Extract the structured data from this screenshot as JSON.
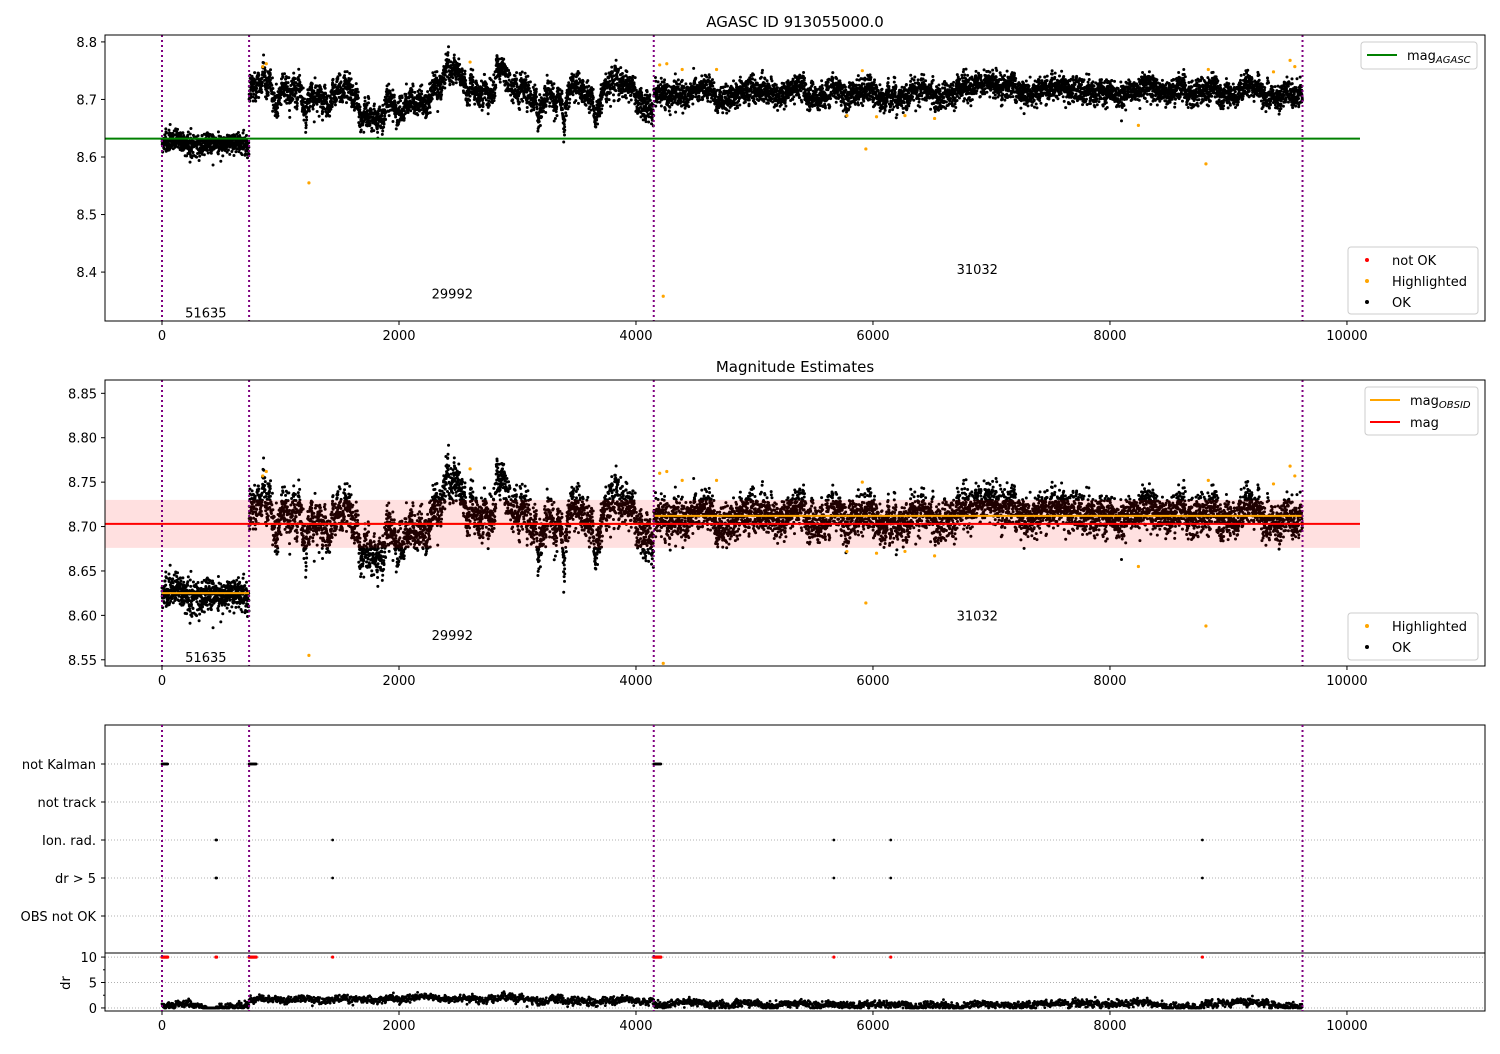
{
  "chart_data": [
    {
      "type": "scatter",
      "title": "AGASC ID 913055000.0",
      "xlim": [
        -481,
        11165
      ],
      "ylim": [
        8.315,
        8.812
      ],
      "yticks": [
        8.4,
        8.5,
        8.6,
        8.7,
        8.8
      ],
      "xticks": [
        0,
        2000,
        4000,
        6000,
        8000,
        10000
      ],
      "obsid_boundaries": [
        0,
        735,
        4150,
        9625
      ],
      "obsids": [
        {
          "label": "51635",
          "x": 370,
          "y": 8.33
        },
        {
          "label": "29992",
          "x": 2450,
          "y": 8.363
        },
        {
          "label": "31032",
          "x": 6880,
          "y": 8.405
        }
      ],
      "segments": [
        {
          "start": 0,
          "end": 735,
          "mean": 8.625,
          "std": 0.009,
          "wander": 0.004
        },
        {
          "start": 735,
          "end": 4150,
          "mean": 8.703,
          "std": 0.011,
          "wander": 0.02
        },
        {
          "start": 4150,
          "end": 9625,
          "mean": 8.712,
          "std": 0.011,
          "wander": 0.008
        }
      ],
      "mag_agasc": 8.632,
      "highlighted": [
        [
          1240,
          8.555
        ],
        [
          4230,
          8.358
        ],
        [
          5940,
          8.614
        ],
        [
          8240,
          8.655
        ],
        [
          8810,
          8.588
        ],
        [
          5780,
          8.672
        ],
        [
          6030,
          8.67
        ],
        [
          6520,
          8.667
        ],
        [
          6270,
          8.672
        ],
        [
          850,
          8.757
        ],
        [
          880,
          8.762
        ],
        [
          2600,
          8.765
        ],
        [
          4200,
          8.76
        ],
        [
          4260,
          8.762
        ],
        [
          4390,
          8.752
        ],
        [
          4680,
          8.752
        ],
        [
          5910,
          8.75
        ],
        [
          8830,
          8.752
        ],
        [
          9380,
          8.748
        ],
        [
          9520,
          8.768
        ],
        [
          9560,
          8.757
        ]
      ],
      "legend_lines": [
        {
          "label": "mag",
          "sub": "AGASC",
          "color": "#008000"
        }
      ],
      "legend_points": [
        {
          "label": "not OK",
          "color": "#ff0000"
        },
        {
          "label": "Highlighted",
          "color": "#ffa500"
        },
        {
          "label": "OK",
          "color": "#000000"
        }
      ]
    },
    {
      "type": "scatter",
      "title": "Magnitude Estimates",
      "xlim": [
        -481,
        11165
      ],
      "ylim": [
        8.543,
        8.865
      ],
      "yticks": [
        8.55,
        8.6,
        8.65,
        8.7,
        8.75,
        8.8,
        8.85
      ],
      "xticks": [
        0,
        2000,
        4000,
        6000,
        8000,
        10000
      ],
      "obsids": [
        {
          "label": "51635",
          "x": 370,
          "y": 8.553
        },
        {
          "label": "29992",
          "x": 2450,
          "y": 8.578
        },
        {
          "label": "31032",
          "x": 6880,
          "y": 8.6
        }
      ],
      "mag": 8.703,
      "mag_band": [
        8.676,
        8.73
      ],
      "mag_extent": [
        -481,
        10110
      ],
      "mag_obsid": [
        {
          "start": 0,
          "end": 735,
          "value": 8.625
        },
        {
          "start": 735,
          "end": 4150,
          "value": 8.703
        },
        {
          "start": 4150,
          "end": 9625,
          "value": 8.712
        }
      ],
      "legend_lines": [
        {
          "label": "mag",
          "sub": "OBSID",
          "color": "#ffa500"
        },
        {
          "label": "mag",
          "sub": "",
          "color": "#ff0000"
        }
      ],
      "legend_points": [
        {
          "label": "Highlighted",
          "color": "#ffa500"
        },
        {
          "label": "OK",
          "color": "#000000"
        }
      ]
    },
    {
      "type": "scatter",
      "title": "",
      "categories": [
        "not Kalman",
        "not track",
        "Ion. rad.",
        "dr > 5",
        "OBS not OK"
      ],
      "flags": {
        "not Kalman": [
          [
            0,
            50
          ],
          [
            735,
            800
          ],
          [
            4150,
            4210
          ]
        ],
        "Ion. rad.": [
          [
            455,
            465
          ],
          [
            1440,
            1445
          ],
          [
            5670,
            5675
          ],
          [
            6150,
            6155
          ],
          [
            8780,
            8785
          ]
        ],
        "dr > 5": [
          [
            455,
            465
          ],
          [
            1440,
            1445
          ],
          [
            5670,
            5675
          ],
          [
            6150,
            6155
          ],
          [
            8780,
            8785
          ]
        ]
      },
      "dr_ylabel": "dr",
      "dr_yticks": [
        0,
        5,
        10
      ],
      "dr_ylim": [
        -0.6,
        10.8
      ],
      "dr_clip": 10,
      "dr_segments": [
        {
          "start": 0,
          "end": 735,
          "mean": 0.5
        },
        {
          "start": 735,
          "end": 4150,
          "mean": 1.6
        },
        {
          "start": 4150,
          "end": 9625,
          "mean": 0.7
        }
      ]
    }
  ]
}
